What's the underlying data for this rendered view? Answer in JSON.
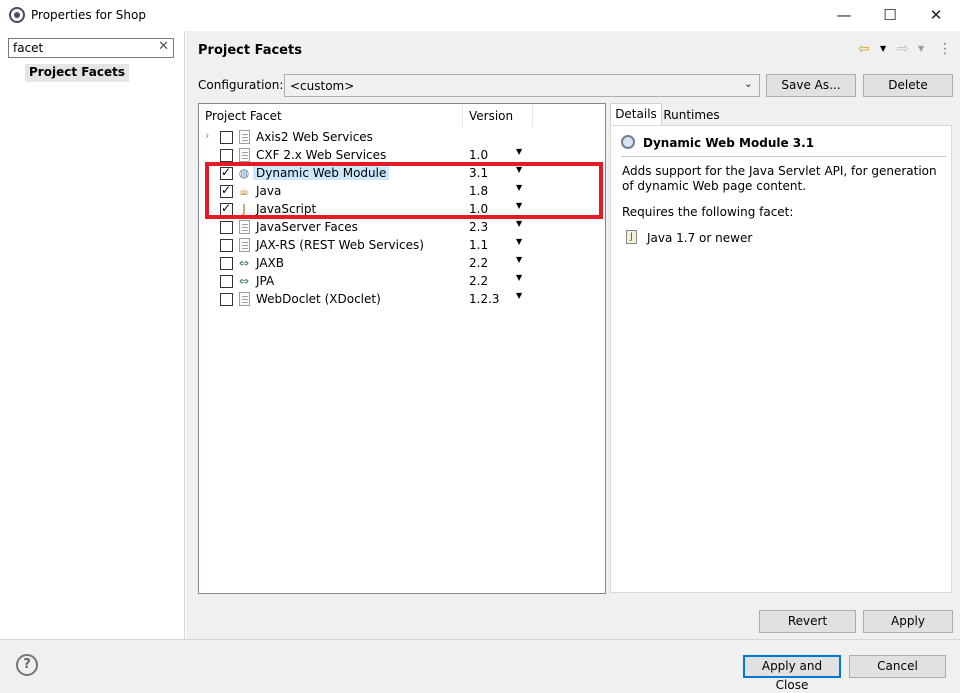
{
  "window": {
    "title": "Properties for Shop",
    "minimize": "—",
    "maximize": "☐",
    "close": "✕"
  },
  "sidebar": {
    "filter_value": "facet",
    "filter_clear": "✕",
    "items": [
      {
        "label": "Project Facets"
      }
    ]
  },
  "page": {
    "title": "Project Facets",
    "back_icon": "⇦",
    "forward_icon": "⇨",
    "menu_icon": "⋮"
  },
  "configuration": {
    "label": "Configuration:",
    "value": "<custom>",
    "save_as": "Save As...",
    "delete": "Delete"
  },
  "facet_table": {
    "headers": {
      "facet": "Project Facet",
      "version": "Version"
    },
    "rows": [
      {
        "name": "Axis2 Web Services",
        "version": "",
        "checked": false,
        "icon": "doc-icon",
        "expander": true
      },
      {
        "name": "CXF 2.x Web Services",
        "version": "1.0",
        "checked": false,
        "icon": "doc-icon"
      },
      {
        "name": "Dynamic Web Module",
        "version": "3.1",
        "checked": true,
        "icon": "web-module-icon",
        "selected": true
      },
      {
        "name": "Java",
        "version": "1.8",
        "checked": true,
        "icon": "java-icon"
      },
      {
        "name": "JavaScript",
        "version": "1.0",
        "checked": true,
        "icon": "javascript-icon"
      },
      {
        "name": "JavaServer Faces",
        "version": "2.3",
        "checked": false,
        "icon": "doc-icon"
      },
      {
        "name": "JAX-RS (REST Web Services)",
        "version": "1.1",
        "checked": false,
        "icon": "doc-icon"
      },
      {
        "name": "JAXB",
        "version": "2.2",
        "checked": false,
        "icon": "arrows-icon"
      },
      {
        "name": "JPA",
        "version": "2.2",
        "checked": false,
        "icon": "arrows-icon"
      },
      {
        "name": "WebDoclet (XDoclet)",
        "version": "1.2.3",
        "checked": false,
        "icon": "doc-icon"
      }
    ]
  },
  "details": {
    "tabs": [
      "Details",
      "Runtimes"
    ],
    "title": "Dynamic Web Module 3.1",
    "description": "Adds support for the Java Servlet API, for generation of dynamic Web page content.",
    "requires_label": "Requires the following facet:",
    "requirement": "Java 1.7 or newer"
  },
  "actions": {
    "revert": "Revert",
    "apply": "Apply",
    "apply_close": "Apply and Close",
    "cancel": "Cancel",
    "help": "?"
  },
  "colors": {
    "highlight": "#e21b24",
    "selection": "#cce8ff",
    "default_button_border": "#0078d7"
  }
}
